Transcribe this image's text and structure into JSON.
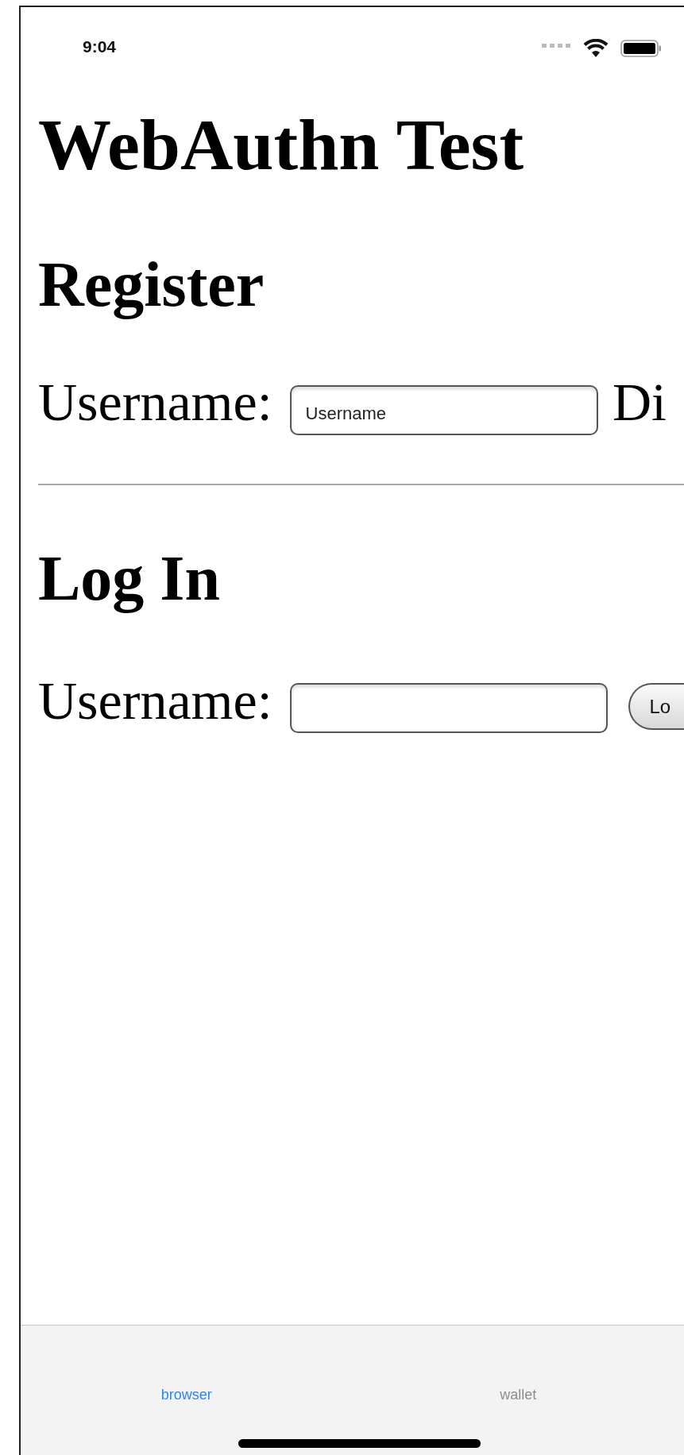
{
  "status_bar": {
    "time": "9:04"
  },
  "page": {
    "title": "WebAuthn Test",
    "sections": [
      {
        "heading": "Register",
        "row": [
          {
            "kind": "label",
            "text": "Username:"
          },
          {
            "kind": "input",
            "placeholder": "Username"
          },
          {
            "kind": "label",
            "text": "Di"
          }
        ]
      },
      {
        "heading": "Log In",
        "row": [
          {
            "kind": "label",
            "text": "Username:"
          },
          {
            "kind": "input"
          },
          {
            "kind": "button",
            "label": "Lo"
          }
        ]
      }
    ]
  },
  "tab_bar": {
    "tabs": [
      {
        "label": "browser",
        "selected": true
      },
      {
        "label": "wallet",
        "selected": false
      }
    ]
  }
}
